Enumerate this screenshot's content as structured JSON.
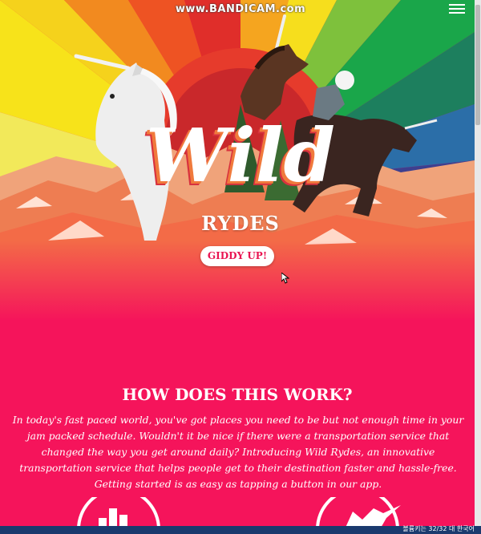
{
  "watermark": {
    "text": "www.BANDICAM.com"
  },
  "header": {
    "menu_icon": "hamburger-menu-icon"
  },
  "hero": {
    "logo_wild": "Wild",
    "logo_rydes": "RYDES",
    "cta_label": "GIDDY UP!"
  },
  "section": {
    "title": "HOW DOES THIS WORK?",
    "body": "In today's fast paced world, you've got places you need to be but not enough time in your jam packed schedule. Wouldn't it be nice if there were a transportation service that changed the way you get around daily? Introducing Wild Rydes, an innovative transportation service that helps people get to their destination faster and hassle-free. Getting started is as easy as tapping a button in our app."
  },
  "features": [
    {
      "icon": "building-icon"
    },
    {
      "icon": "unicorn-icon"
    }
  ],
  "taskbar": {
    "text": "볼륨키는 32/32  대  한국어"
  },
  "colors": {
    "accent": "#f5145b",
    "cta_text": "#e91552",
    "white": "#ffffff"
  }
}
